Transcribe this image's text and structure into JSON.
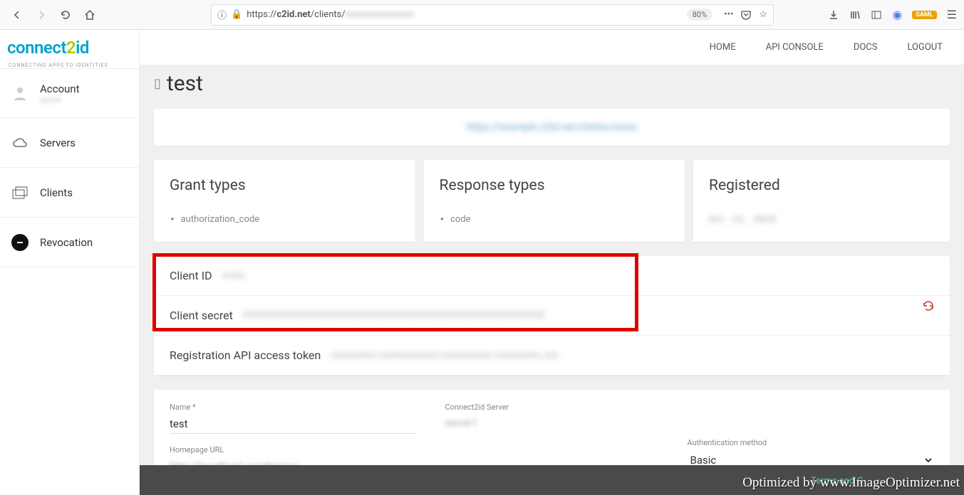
{
  "browser": {
    "url_prefix": "https://",
    "url_domain": "c2id.net",
    "url_path": "/clients/",
    "zoom": "80%"
  },
  "brand": {
    "part1": "connect",
    "part2": "2",
    "part3": "id",
    "tag": "CONNECTING APPS TO IDENTITIES"
  },
  "topnav": {
    "home": "HOME",
    "api": "API CONSOLE",
    "docs": "DOCS",
    "logout": "LOGOUT"
  },
  "sidebar": {
    "account": {
      "label": "Account",
      "sub": "admin"
    },
    "servers": "Servers",
    "clients": "Clients",
    "revocation": "Revocation"
  },
  "page": {
    "title": "test"
  },
  "banner": {
    "text": "https://example.c2id.net/clients/xxxxx"
  },
  "cards": {
    "grant": {
      "title": "Grant types",
      "value": "authorization_code"
    },
    "response": {
      "title": "Response types",
      "value": "code"
    },
    "registered": {
      "title": "Registered",
      "value": "Oct 14, 2019"
    }
  },
  "creds": {
    "client_id_label": "Client ID",
    "client_id_value": "xxxxx",
    "client_secret_label": "Client secret",
    "client_secret_value": "XXXXXXXXXXXXXXXXXXXXXXXXXXXXXXXXXXXXXXXXXXXXXXXXXXXX",
    "token_label": "Registration API access token",
    "token_value": "xxxxxxxxxx.xxxxxxxxxxxxx.xxxxxxxxxxx.xxxxxxxxxx_xxx"
  },
  "form": {
    "name_label": "Name *",
    "name_value": "test",
    "server_label": "Connect2id Server",
    "server_value": "server1",
    "homepage_label": "Homepage URL",
    "homepage_value": "http://localhost.wordpress/",
    "auth_label": "Authentication method",
    "auth_value": "Basic"
  },
  "footer": {
    "terms": "Terms and C",
    "watermark": "Optimized by www.ImageOptimizer.net"
  }
}
